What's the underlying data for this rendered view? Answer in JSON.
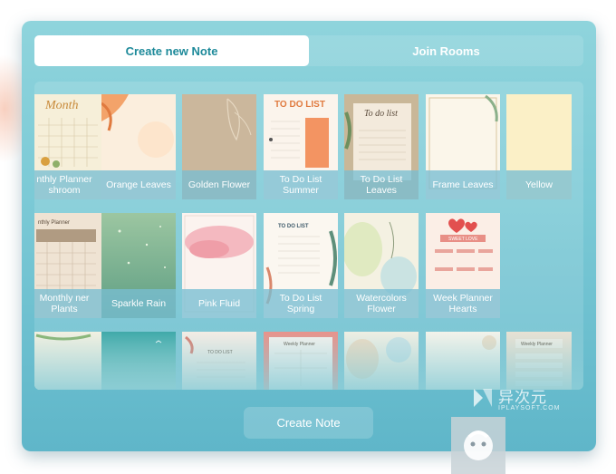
{
  "tabs": [
    {
      "label": "Create new Note",
      "active": true
    },
    {
      "label": "Join Rooms",
      "active": false
    }
  ],
  "templates": {
    "row1": [
      {
        "label": "nthly Planner shroom",
        "thumb_text": "Month"
      },
      {
        "label": "Orange Leaves"
      },
      {
        "label": "Golden Flower"
      },
      {
        "label": "To Do List Summer",
        "thumb_text": "TO DO LIST"
      },
      {
        "label": "To Do List Leaves",
        "thumb_text": "To do list"
      },
      {
        "label": "Frame Leaves"
      },
      {
        "label": "Yellow"
      }
    ],
    "row2": [
      {
        "label": "Monthly ner Plants",
        "thumb_text": "nthly Planner"
      },
      {
        "label": "Sparkle Rain"
      },
      {
        "label": "Pink Fluid"
      },
      {
        "label": "To Do List Spring",
        "thumb_text": "TO DO LIST"
      },
      {
        "label": "Watercolors Flower"
      },
      {
        "label": "Week Planner Hearts",
        "thumb_text": "SWEET LOVE"
      }
    ],
    "row3": [
      {
        "label": ""
      },
      {
        "label": ""
      },
      {
        "label": "",
        "thumb_text": "TO DO LIST"
      },
      {
        "label": "",
        "thumb_text": "Weekly Planner"
      },
      {
        "label": ""
      },
      {
        "label": ""
      },
      {
        "label": "",
        "thumb_text": "Weekly Planner"
      }
    ]
  },
  "actions": {
    "create_label": "Create Note"
  },
  "watermark": {
    "name": "异次元",
    "sub": "IPLAYSOFT.COM"
  },
  "colors": {
    "accent": "#1e8a9a",
    "panel": "#7ccad6"
  }
}
